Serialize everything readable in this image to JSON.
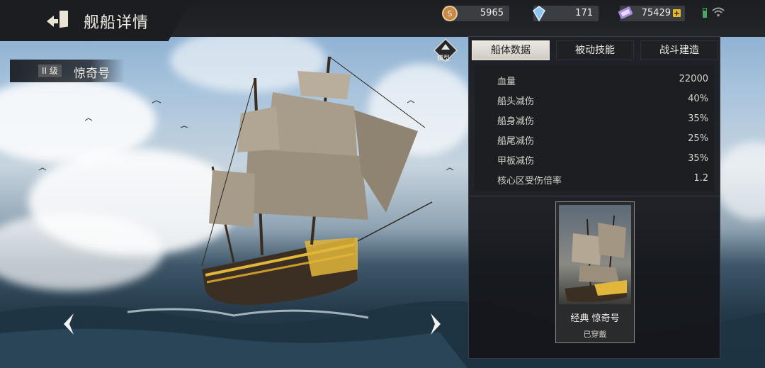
{
  "header": {
    "title": "舰船详情",
    "resources": [
      {
        "icon": "silver-coin-icon",
        "value": "5965"
      },
      {
        "icon": "diamond-icon",
        "value": "171"
      },
      {
        "icon": "crystal-ticket-icon",
        "value": "75429"
      }
    ],
    "add_label": "+"
  },
  "ship": {
    "grade": "II 级",
    "name": "惊奇号"
  },
  "model_button": {
    "label": "模型"
  },
  "tabs": [
    {
      "label": "船体数据",
      "active": true
    },
    {
      "label": "被动技能",
      "active": false
    },
    {
      "label": "战斗建造",
      "active": false
    }
  ],
  "stats": [
    {
      "label": "血量",
      "value": "22000"
    },
    {
      "label": "船头减伤",
      "value": "40%"
    },
    {
      "label": "船身减伤",
      "value": "35%"
    },
    {
      "label": "船尾减伤",
      "value": "25%"
    },
    {
      "label": "甲板减伤",
      "value": "35%"
    },
    {
      "label": "核心区受伤倍率",
      "value": "1.2"
    }
  ],
  "skin": {
    "name": "经典 惊奇号",
    "status": "已穿戴"
  },
  "colors": {
    "accent_gold": "#e5b92b",
    "battery_green": "#4aa861",
    "panel_bg": "#14161a"
  }
}
